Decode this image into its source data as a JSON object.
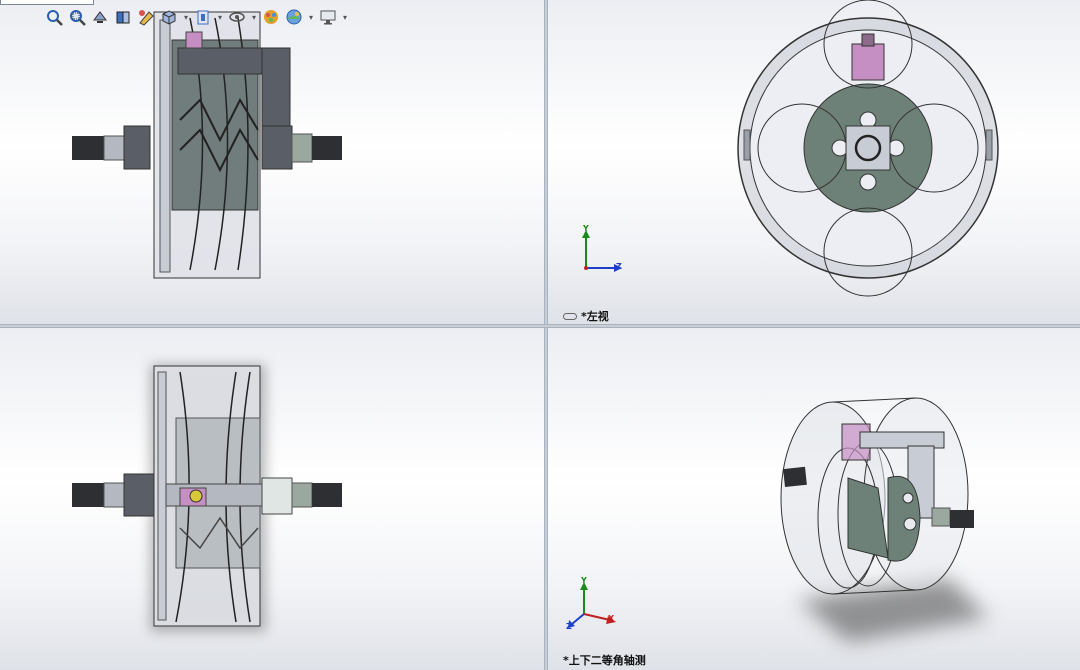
{
  "viewports": {
    "top_left": {},
    "top_right": {
      "label": "*左视",
      "label_icon": "link-icon"
    },
    "bottom_left": {},
    "bottom_right": {
      "label": "*上下二等角轴测"
    }
  },
  "toolbar": {
    "items": [
      {
        "icon": "zoom-to-fit-icon"
      },
      {
        "icon": "zoom-to-area-icon"
      },
      {
        "icon": "previous-view-icon"
      },
      {
        "icon": "section-view-icon"
      },
      {
        "icon": "dynamic-annotation-icon"
      },
      {
        "icon": "view-orientation-icon",
        "has_dropdown": true
      },
      {
        "icon": "display-style-icon",
        "has_dropdown": true
      },
      {
        "icon": "hide-show-items-icon",
        "has_dropdown": true
      },
      {
        "icon": "edit-appearance-icon"
      },
      {
        "icon": "apply-scene-icon",
        "has_dropdown": true
      },
      {
        "icon": "view-settings-icon",
        "has_dropdown": true
      }
    ]
  },
  "triad": {
    "axis_x": "X",
    "axis_y": "Y",
    "axis_z": "Z"
  },
  "colors": {
    "model_gray": "#c8ccd4",
    "model_dark": "#4a5a57",
    "model_green": "#6e8178",
    "pink_part": "#c68fc3",
    "axis_x": "#c02020",
    "axis_y": "#1a8a1a",
    "axis_z": "#1d3fc4"
  }
}
